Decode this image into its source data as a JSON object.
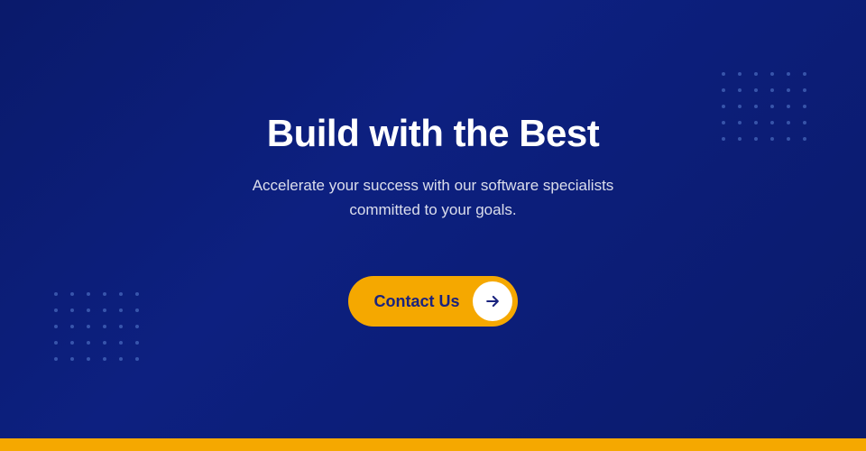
{
  "hero": {
    "title": "Build with the Best",
    "subtitle": "Accelerate your success with our software specialists committed to your goals.",
    "cta_label": "Contact Us",
    "bg_color": "#0a1a6b",
    "accent_color": "#f5a800",
    "text_color": "#ffffff"
  },
  "dots": {
    "count": 30
  },
  "bottom_bar": {
    "color": "#f5a800"
  }
}
